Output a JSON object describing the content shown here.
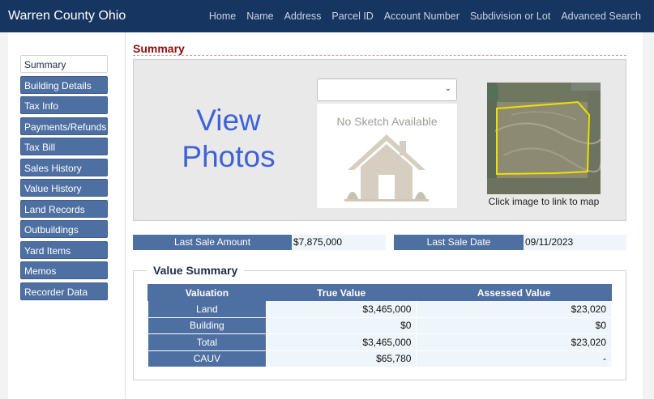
{
  "header": {
    "brand": "Warren County Ohio",
    "nav": [
      "Home",
      "Name",
      "Address",
      "Parcel ID",
      "Account Number",
      "Subdivision or Lot",
      "Advanced Search"
    ]
  },
  "sidebar": {
    "items": [
      "Summary",
      "Building Details",
      "Tax Info",
      "Payments/Refunds",
      "Tax Bill",
      "Sales History",
      "Value History",
      "Land Records",
      "Outbuildings",
      "Yard Items",
      "Memos",
      "Recorder Data"
    ],
    "active_index": 0
  },
  "summary": {
    "title": "Summary",
    "view_photos_line1": "View",
    "view_photos_line2": "Photos",
    "sketch_select_value": "",
    "no_sketch_text": "No Sketch Available",
    "map_caption": "Click image to link to map"
  },
  "sale": {
    "last_sale_amount_label": "Last Sale Amount",
    "last_sale_amount": "$7,875,000",
    "last_sale_date_label": "Last Sale Date",
    "last_sale_date": "09/11/2023"
  },
  "value_summary": {
    "legend": "Value Summary",
    "headers": [
      "Valuation",
      "True Value",
      "Assessed Value"
    ],
    "rows": [
      [
        "Land",
        "$3,465,000",
        "$23,020"
      ],
      [
        "Building",
        "$0",
        "$0"
      ],
      [
        "Total",
        "$3,465,000",
        "$23,020"
      ],
      [
        "CAUV",
        "$65,780",
        "-"
      ]
    ]
  },
  "colors": {
    "header_bg": "#163561",
    "accent_blue": "#4e6fa2",
    "title_red": "#8b0d0d",
    "link_blue": "#3f63d6",
    "parcel_outline": "#f0e000"
  },
  "icons": {
    "sketch_placeholder": "house-icon",
    "select_arrow": "chevron-down-icon"
  }
}
